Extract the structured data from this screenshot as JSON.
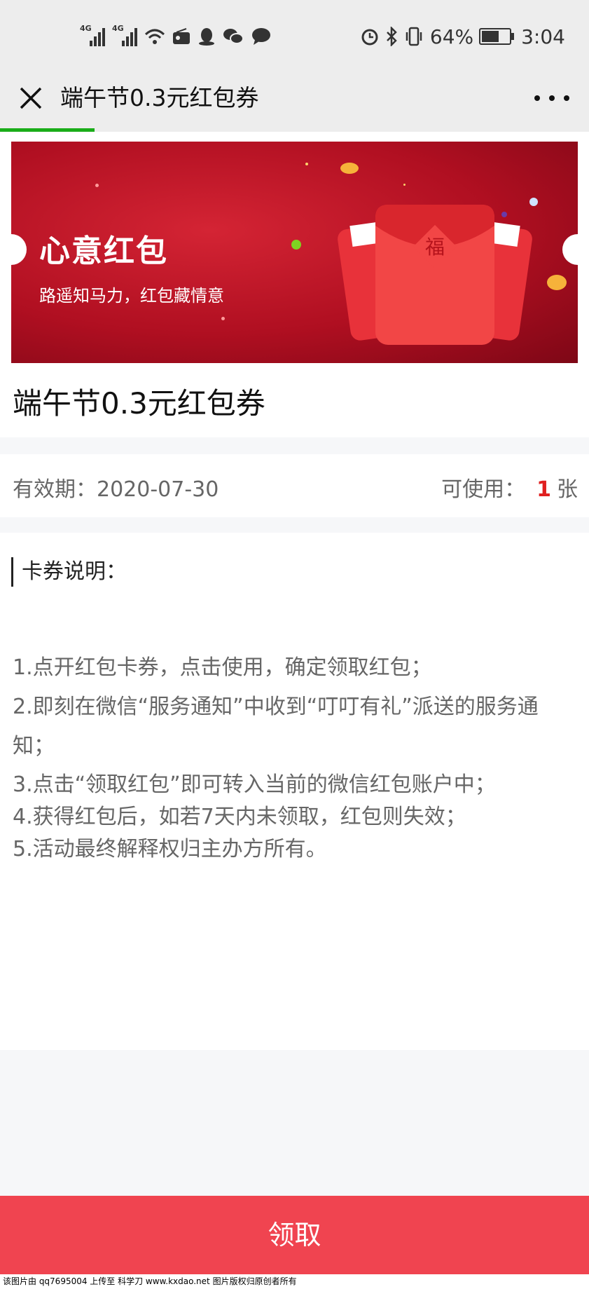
{
  "status_bar": {
    "network_1": "4G",
    "network_2": "4G",
    "battery_percent": "64%",
    "battery_level": 0.64,
    "time": "3:04",
    "icons": [
      "signal-icon",
      "signal-icon",
      "wifi-icon",
      "radio-icon",
      "qq-icon",
      "wechat-icon",
      "message-icon",
      "alarm-icon",
      "bluetooth-icon",
      "vibrate-icon",
      "battery-icon"
    ]
  },
  "nav": {
    "title": "端午节0.3元红包券",
    "progress": 0.16
  },
  "banner": {
    "title": "心意红包",
    "subtitle": "路遥知马力，红包藏情意",
    "envelope_char": "福"
  },
  "coupon": {
    "title": "端午节0.3元红包券",
    "valid_label": "有效期：",
    "valid_date": "2020-07-30",
    "available_label": "可使用：",
    "available_count": "1",
    "available_unit": "张"
  },
  "description": {
    "heading": "卡券说明：",
    "items": [
      "1.点开红包卡券，点击使用，确定领取红包；",
      "2.即刻在微信“服务通知”中收到“叮叮有礼”派送的服务通知；",
      "3.点击“领取红包”即可转入当前的微信红包账户中；",
      "4.获得红包后，如若7天内未领取，红包则失效；",
      "5.活动最终解释权归主办方所有。"
    ]
  },
  "action": {
    "claim_label": "领取"
  },
  "watermark": "该图片由 qq7695004 上传至 科学刀 www.kxdao.net 图片版权归原创者所有",
  "colors": {
    "accent_red": "#f04450",
    "count_red": "#e02020",
    "progress_green": "#1aad19"
  }
}
